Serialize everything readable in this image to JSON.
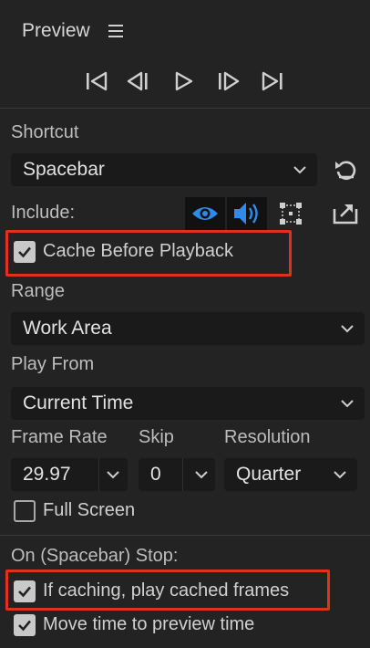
{
  "panel": {
    "title": "Preview"
  },
  "transport": {
    "buttons": [
      "first-frame-icon",
      "previous-frame-icon",
      "play-icon",
      "next-frame-icon",
      "last-frame-icon"
    ]
  },
  "shortcut": {
    "label": "Shortcut",
    "value": "Spacebar"
  },
  "include": {
    "label": "Include:"
  },
  "cache_before_playback": {
    "label": "Cache Before Playback",
    "checked": true
  },
  "range": {
    "label": "Range",
    "value": "Work Area"
  },
  "play_from": {
    "label": "Play From",
    "value": "Current Time"
  },
  "frame_rate": {
    "label": "Frame Rate",
    "value": "29.97"
  },
  "skip": {
    "label": "Skip",
    "value": "0"
  },
  "resolution": {
    "label": "Resolution",
    "value": "Quarter"
  },
  "full_screen": {
    "label": "Full Screen",
    "checked": false
  },
  "stop": {
    "label": "On (Spacebar) Stop:",
    "play_cached": {
      "label": "If caching, play cached frames",
      "checked": true
    },
    "move_time": {
      "label": "Move time to preview time",
      "checked": true
    }
  },
  "colors": {
    "accent": "#2d8ceb",
    "highlight": "#e0301e",
    "background": "#232323"
  }
}
